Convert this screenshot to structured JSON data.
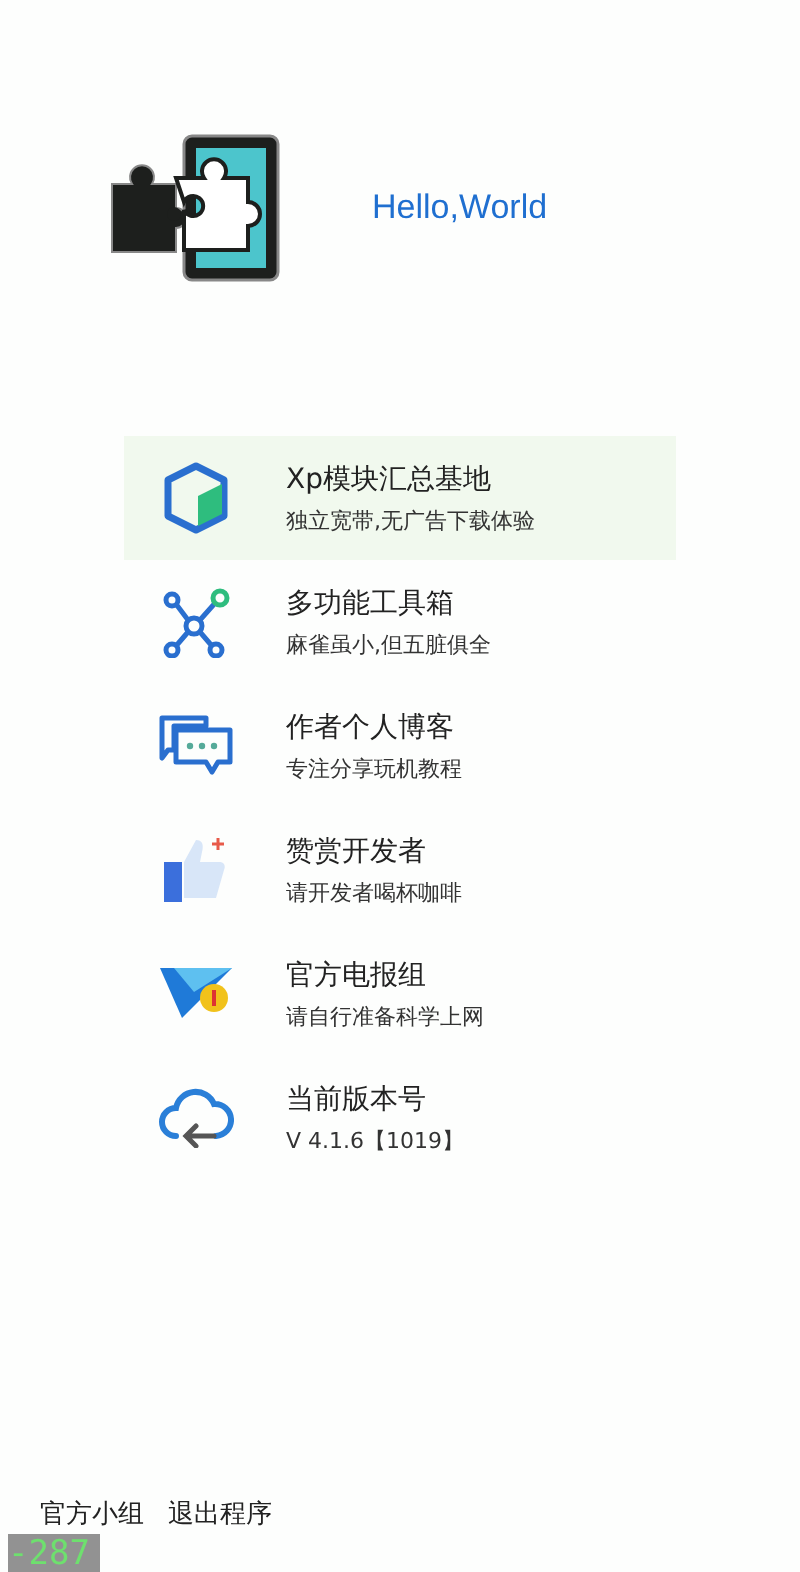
{
  "header": {
    "title": "Hello,World"
  },
  "menu": [
    {
      "kind": "box",
      "title": "Xp模块汇总基地",
      "subtitle": "独立宽带,无广告下载体验",
      "selected": true
    },
    {
      "kind": "network",
      "title": "多功能工具箱",
      "subtitle": "麻雀虽小,但五脏俱全",
      "selected": false
    },
    {
      "kind": "chat",
      "title": "作者个人博客",
      "subtitle": "专注分享玩机教程",
      "selected": false
    },
    {
      "kind": "thumb",
      "title": "赞赏开发者",
      "subtitle": "请开发者喝杯咖啡",
      "selected": false
    },
    {
      "kind": "plane",
      "title": "官方电报组",
      "subtitle": "请自行准备科学上网",
      "selected": false
    },
    {
      "kind": "cloud",
      "title": "当前版本号",
      "subtitle": "V 4.1.6【1019】",
      "selected": false
    }
  ],
  "footer": {
    "links": [
      "官方小组",
      "退出程序"
    ]
  },
  "debug_overlay": {
    "value": "-287"
  }
}
